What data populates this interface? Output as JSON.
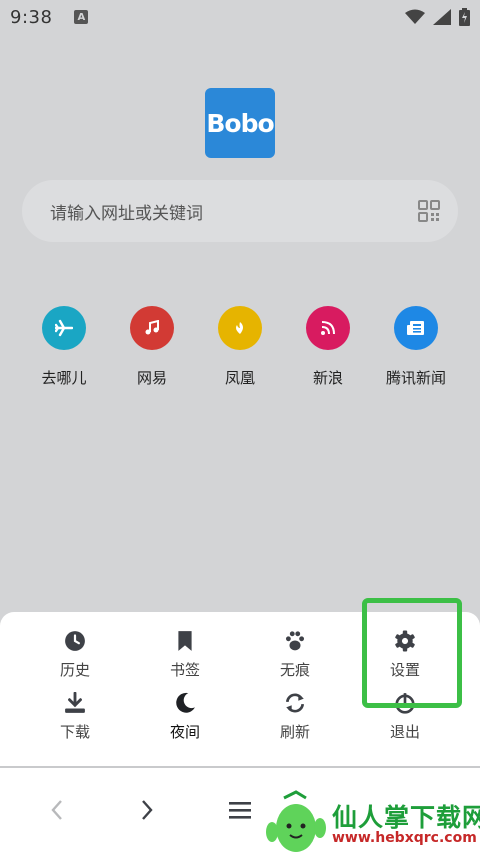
{
  "status_bar": {
    "time": "9:38",
    "notification_icon": "A"
  },
  "logo": {
    "text": "Bobo"
  },
  "search": {
    "placeholder": "请输入网址或关键词"
  },
  "shortcuts": [
    {
      "label": "去哪儿",
      "icon": "plane-icon",
      "color": "#1aa6c4"
    },
    {
      "label": "网易",
      "icon": "music-icon",
      "color": "#d23a34"
    },
    {
      "label": "凤凰",
      "icon": "phoenix-icon",
      "color": "#e6b400"
    },
    {
      "label": "新浪",
      "icon": "rss-icon",
      "color": "#d81b60"
    },
    {
      "label": "腾讯新闻",
      "icon": "news-icon",
      "color": "#1e88e5"
    }
  ],
  "menu": {
    "items": [
      {
        "label": "历史",
        "icon": "clock-icon"
      },
      {
        "label": "书签",
        "icon": "bookmark-icon"
      },
      {
        "label": "无痕",
        "icon": "paw-icon"
      },
      {
        "label": "设置",
        "icon": "gear-icon"
      },
      {
        "label": "下载",
        "icon": "download-icon"
      },
      {
        "label": "夜间",
        "icon": "moon-icon"
      },
      {
        "label": "刷新",
        "icon": "refresh-icon"
      },
      {
        "label": "退出",
        "icon": "power-icon"
      }
    ]
  },
  "watermark": {
    "text": "仙人掌下载网",
    "url": "www.hebxqrc.com"
  },
  "colors": {
    "highlight": "#3cbf46",
    "logo_bg": "#2b88d8",
    "backdrop": "#d3d4d6"
  }
}
